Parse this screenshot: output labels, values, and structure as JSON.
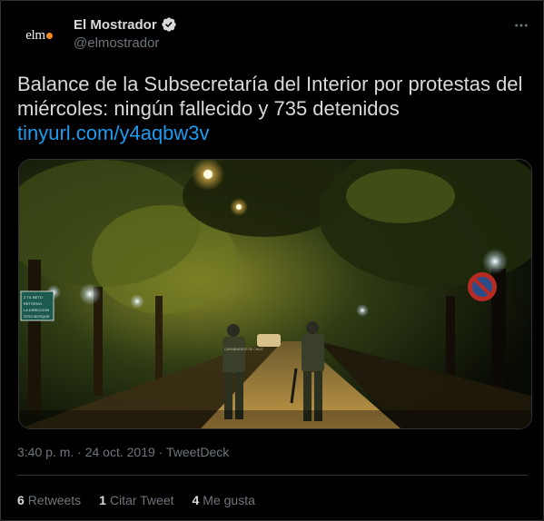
{
  "author": {
    "avatar_text": "elm",
    "display_name": "El Mostrador",
    "handle": "@elmostrador",
    "verified": true
  },
  "tweet": {
    "text": "Balance de la Subsecretaría del Interior por protestas del miércoles: ningún fallecido y 735 detenidos",
    "link": "tinyurl.com/y4aqbw3v"
  },
  "media": {
    "sign_text": [
      "2 TIL BETO",
      "RETORNO",
      "LA DIRECCION",
      "SITIO BOSQUE"
    ],
    "vest_label": "CARABINEROS DE CHILE"
  },
  "meta": {
    "time": "3:40 p. m.",
    "separator": "·",
    "date": "24 oct. 2019",
    "source": "TweetDeck"
  },
  "stats": {
    "retweets_count": "6",
    "retweets_label": "Retweets",
    "quotes_count": "1",
    "quotes_label": "Citar Tweet",
    "likes_count": "4",
    "likes_label": "Me gusta"
  },
  "colors": {
    "background": "#000000",
    "text": "#d9d9d9",
    "muted": "#6e767d",
    "link": "#1d9bf0",
    "verified_badge": "#d9d9d9",
    "border": "#2f3336"
  }
}
